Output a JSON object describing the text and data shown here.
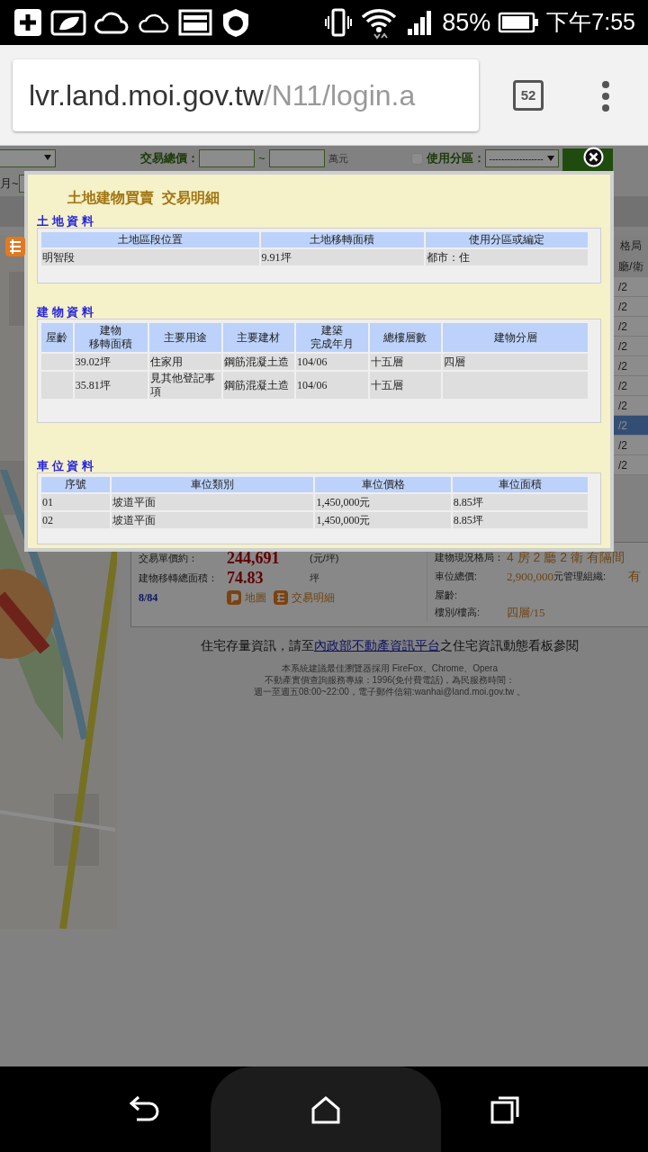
{
  "status_bar": {
    "battery": "85%",
    "time": "下午7:55"
  },
  "browser": {
    "url_host": "lvr.land.moi.gov.tw",
    "url_path": "/N11/login.a",
    "tab_count": "52"
  },
  "filters": {
    "total_price_label": "交易總價：",
    "range_separator": "~",
    "unit": "萬元",
    "zone_checkbox": {
      "label": "使用分區：",
      "checked": false
    },
    "zone_select": "------------------",
    "date_separator": "月~"
  },
  "results_column": {
    "header_1": "格局",
    "header_2": "廳/衛",
    "rows": [
      {
        "text": "/2",
        "selected": false
      },
      {
        "text": "/2",
        "selected": false
      },
      {
        "text": "/2",
        "selected": false
      },
      {
        "text": "/2",
        "selected": false
      },
      {
        "text": "/2",
        "selected": false
      },
      {
        "text": "/2",
        "selected": false
      },
      {
        "text": "/2",
        "selected": false
      },
      {
        "text": "/2",
        "selected": true
      },
      {
        "text": "/2",
        "selected": false
      },
      {
        "text": "/2",
        "selected": false
      }
    ]
  },
  "detail": {
    "unit_price_label": "交易單價約：",
    "unit_price": "244,691",
    "unit_price_unit": "(元/坪)",
    "area_label": "建物移轉總面積：",
    "area": "74.83",
    "area_unit": "坪",
    "page": "8/84",
    "map_link": "地圖",
    "detail_link": "交易明細",
    "layout_label": "建物現況格局：",
    "layout": "4 房 2 廳 2 衛 有隔間",
    "parking_total_label": "車位總價:",
    "parking_total": "2,900,000",
    "parking_total_unit": "元",
    "management_label": "管理組織:",
    "management": "有",
    "age_label": "屋齡:",
    "floor_label": "樓別/樓高:",
    "floor": "四層/15"
  },
  "footer": {
    "before_link": "住宅存量資訊，請至",
    "link": "內政部不動產資訊平台",
    "after_link": "之住宅資訊動態看板參閱",
    "notes": [
      "本系統建議最佳瀏覽器採用 FireFox、Chrome、Opera",
      "不動產實價查詢服務專線：1996(免付費電話)，為民服務時間：",
      "週一至週五08:00~22:00，電子郵件信箱:wanhai@land.moi.gov.tw 。"
    ]
  },
  "modal": {
    "title": "土地建物買賣  交易明細",
    "land": {
      "heading": "土 地 資 料",
      "columns": [
        "土地區段位置",
        "土地移轉面積",
        "使用分區或編定"
      ],
      "rows": [
        [
          "明智段",
          "9.91坪",
          "都市：住"
        ]
      ]
    },
    "building": {
      "heading": "建 物 資 料",
      "columns": [
        "屋齡",
        [
          "建物",
          "移轉面積"
        ],
        "主要用途",
        "主要建材",
        [
          "建築",
          "完成年月"
        ],
        "總樓層數",
        "建物分層"
      ],
      "rows": [
        [
          "",
          "39.02坪",
          "住家用",
          "鋼筋混凝土造",
          "104/06",
          "十五層",
          "四層"
        ],
        [
          "",
          "35.81坪",
          "見其他登記事項",
          "鋼筋混凝土造",
          "104/06",
          "十五層",
          ""
        ]
      ]
    },
    "parking": {
      "heading": "車 位 資 料",
      "columns": [
        "序號",
        "車位類別",
        "車位價格",
        "車位面積"
      ],
      "rows": [
        [
          "01",
          "坡道平面",
          "1,450,000元",
          "8.85坪"
        ],
        [
          "02",
          "坡道平面",
          "1,450,000元",
          "8.85坪"
        ]
      ]
    }
  }
}
